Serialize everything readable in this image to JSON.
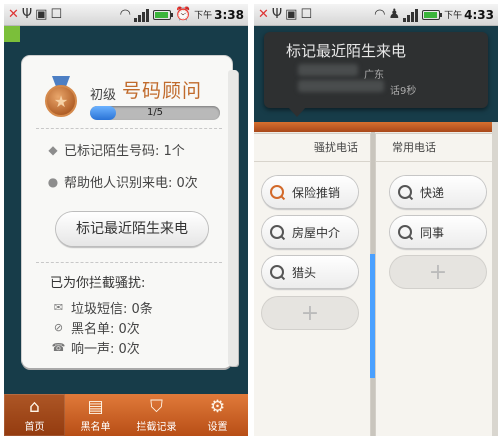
{
  "left": {
    "status": {
      "ampm": "下午",
      "time": "3:38",
      "battery_level": 0.9
    },
    "level_label": "初级",
    "rank_title": "号码顾问",
    "progress": {
      "text": "1/5",
      "value": 0.2
    },
    "stats": [
      {
        "icon": "tag-icon",
        "label": "已标记陌生号码: 1个"
      },
      {
        "icon": "person-icon",
        "label": "帮助他人识别来电: 0次"
      }
    ],
    "mark_button": "标记最近陌生来电",
    "block_title": "已为你拦截骚扰:",
    "block_items": [
      {
        "icon": "envelope-icon",
        "label": "垃圾短信: 0条"
      },
      {
        "icon": "ban-icon",
        "label": "黑名单: 0次"
      },
      {
        "icon": "phone-icon",
        "label": "响一声: 0次"
      }
    ],
    "tabs": [
      {
        "icon": "home-icon",
        "label": "首页",
        "active": true
      },
      {
        "icon": "blacklist-icon",
        "label": "黑名单",
        "active": false
      },
      {
        "icon": "shield-icon",
        "label": "拦截记录",
        "active": false
      },
      {
        "icon": "gear-icon",
        "label": "设置",
        "active": false
      }
    ]
  },
  "right": {
    "status": {
      "ampm": "下午",
      "time": "4:33",
      "battery_level": 0.9
    },
    "popup": {
      "title": "标记最近陌生来电",
      "location": "广东",
      "duration": "话9秒"
    },
    "harass": {
      "header": "骚扰电话",
      "items": [
        "保险推销",
        "房屋中介",
        "猎头"
      ],
      "add": "+"
    },
    "common": {
      "header": "常用电话",
      "items": [
        "快递",
        "同事"
      ],
      "add": "+"
    }
  },
  "colors": {
    "accent_orange": "#c8602a",
    "dark_bg": "#173c49",
    "progress_blue": "#2a73d6"
  }
}
